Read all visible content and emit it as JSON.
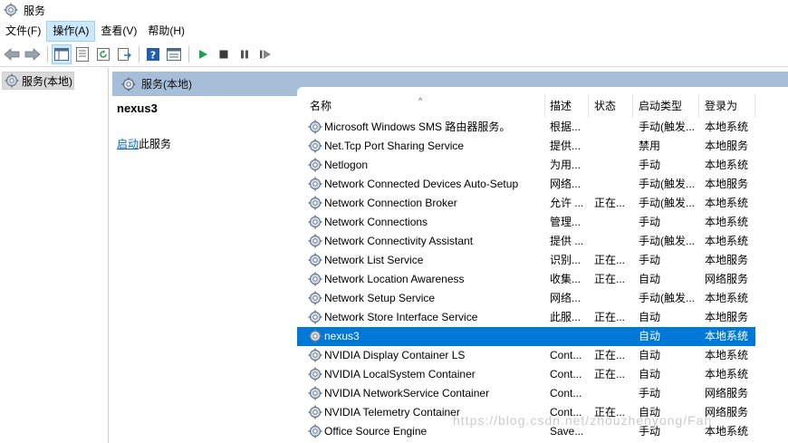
{
  "window": {
    "title": "服务"
  },
  "menu": [
    "文件(F)",
    "操作(A)",
    "查看(V)",
    "帮助(H)"
  ],
  "menu_active_index": 1,
  "toolbar": {
    "buttons": [
      "back-arrow-icon",
      "forward-arrow-icon",
      "console-tree-icon",
      "properties-icon",
      "refresh-icon",
      "export-list-icon",
      "help-icon",
      "view-icon",
      "start-service-icon",
      "stop-service-icon",
      "pause-service-icon",
      "resume-service-icon"
    ]
  },
  "tree": {
    "root_label": "服务(本地)"
  },
  "panel": {
    "header": "服务(本地)"
  },
  "details": {
    "title": "nexus3",
    "action_link": "启动",
    "action_text": "此服务"
  },
  "table": {
    "columns": [
      "名称",
      "描述",
      "状态",
      "启动类型",
      "登录为"
    ],
    "sorted_column": "名称",
    "rows": [
      {
        "name": "Microsoft Windows SMS 路由器服务。",
        "desc": "根据...",
        "status": "",
        "startup": "手动(触发...",
        "logon": "本地系统"
      },
      {
        "name": "Net.Tcp Port Sharing Service",
        "desc": "提供...",
        "status": "",
        "startup": "禁用",
        "logon": "本地服务"
      },
      {
        "name": "Netlogon",
        "desc": "为用...",
        "status": "",
        "startup": "手动",
        "logon": "本地系统"
      },
      {
        "name": "Network Connected Devices Auto-Setup",
        "desc": "网络...",
        "status": "",
        "startup": "手动(触发...",
        "logon": "本地服务"
      },
      {
        "name": "Network Connection Broker",
        "desc": "允许 ...",
        "status": "正在...",
        "startup": "手动(触发...",
        "logon": "本地系统"
      },
      {
        "name": "Network Connections",
        "desc": "管理...",
        "status": "",
        "startup": "手动",
        "logon": "本地系统"
      },
      {
        "name": "Network Connectivity Assistant",
        "desc": "提供 ...",
        "status": "",
        "startup": "手动(触发...",
        "logon": "本地系统"
      },
      {
        "name": "Network List Service",
        "desc": "识别...",
        "status": "正在...",
        "startup": "手动",
        "logon": "本地服务"
      },
      {
        "name": "Network Location Awareness",
        "desc": "收集...",
        "status": "正在...",
        "startup": "自动",
        "logon": "网络服务"
      },
      {
        "name": "Network Setup Service",
        "desc": "网络...",
        "status": "",
        "startup": "手动(触发...",
        "logon": "本地系统"
      },
      {
        "name": "Network Store Interface Service",
        "desc": "此服...",
        "status": "正在...",
        "startup": "自动",
        "logon": "本地服务"
      },
      {
        "name": "nexus3",
        "desc": "",
        "status": "",
        "startup": "自动",
        "logon": "本地系统",
        "selected": true
      },
      {
        "name": "NVIDIA Display Container LS",
        "desc": "Cont...",
        "status": "正在...",
        "startup": "自动",
        "logon": "本地系统"
      },
      {
        "name": "NVIDIA LocalSystem Container",
        "desc": "Cont...",
        "status": "正在...",
        "startup": "自动",
        "logon": "本地系统"
      },
      {
        "name": "NVIDIA NetworkService Container",
        "desc": "Cont...",
        "status": "",
        "startup": "手动",
        "logon": "网络服务"
      },
      {
        "name": "NVIDIA Telemetry Container",
        "desc": "Cont...",
        "status": "正在...",
        "startup": "自动",
        "logon": "网络服务"
      },
      {
        "name": "Office  Source Engine",
        "desc": "Save...",
        "status": "",
        "startup": "手动",
        "logon": "本地系统"
      }
    ]
  },
  "watermark": "https://blog.csdn.net/zhouzhenyong/Fan",
  "colors": {
    "selection": "#0078d7",
    "panel_header": "#a7bed8",
    "link": "#0066cc"
  }
}
